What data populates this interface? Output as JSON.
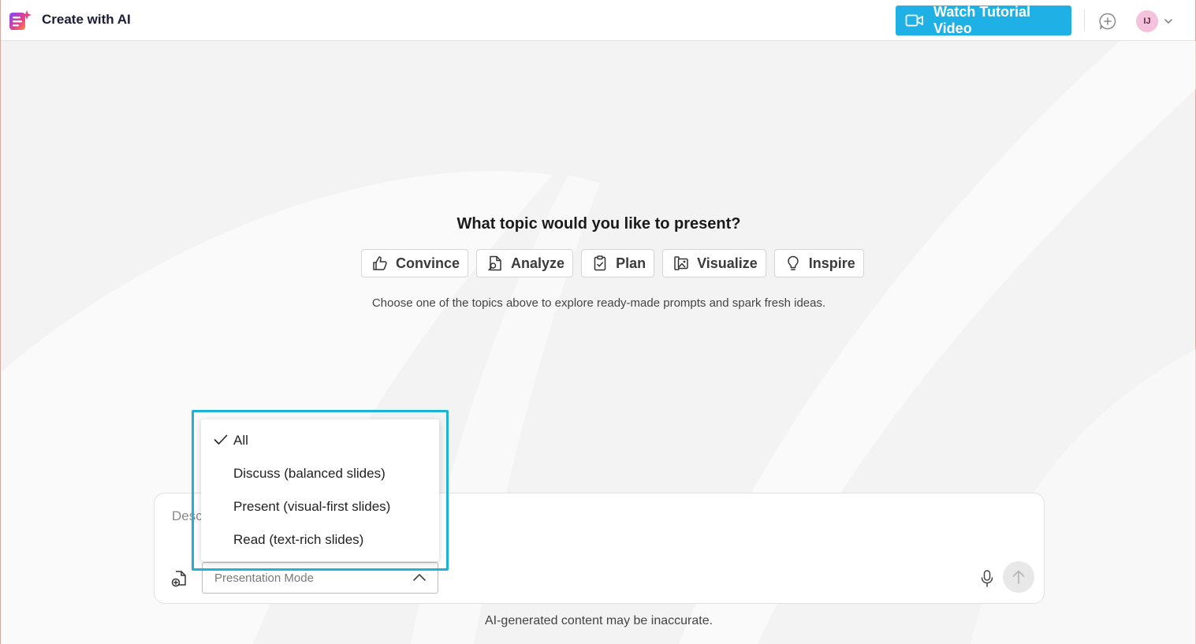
{
  "header": {
    "app_title": "Create with AI",
    "tutorial_button": "Watch Tutorial Video",
    "avatar_initials": "IJ"
  },
  "main": {
    "heading": "What topic would you like to present?",
    "topics": [
      {
        "label": "Convince",
        "icon": "thumbs-up-icon"
      },
      {
        "label": "Analyze",
        "icon": "document-search-icon"
      },
      {
        "label": "Plan",
        "icon": "clipboard-check-icon"
      },
      {
        "label": "Visualize",
        "icon": "images-icon"
      },
      {
        "label": "Inspire",
        "icon": "lightbulb-icon"
      }
    ],
    "hint": "Choose one of the topics above to explore ready-made prompts and spark fresh ideas."
  },
  "composer": {
    "input_placeholder_visible": "Desc",
    "mode_select_placeholder": "Presentation Mode"
  },
  "dropdown": {
    "items": [
      {
        "label": "All",
        "selected": true
      },
      {
        "label": "Discuss (balanced slides)",
        "selected": false
      },
      {
        "label": "Present (visual-first slides)",
        "selected": false
      },
      {
        "label": "Read (text-rich slides)",
        "selected": false
      }
    ]
  },
  "footer": {
    "disclaimer": "AI-generated content may be inaccurate."
  },
  "colors": {
    "accent": "#1fb1e6",
    "highlight": "#1eb3d6",
    "background": "#f3f3f3"
  }
}
